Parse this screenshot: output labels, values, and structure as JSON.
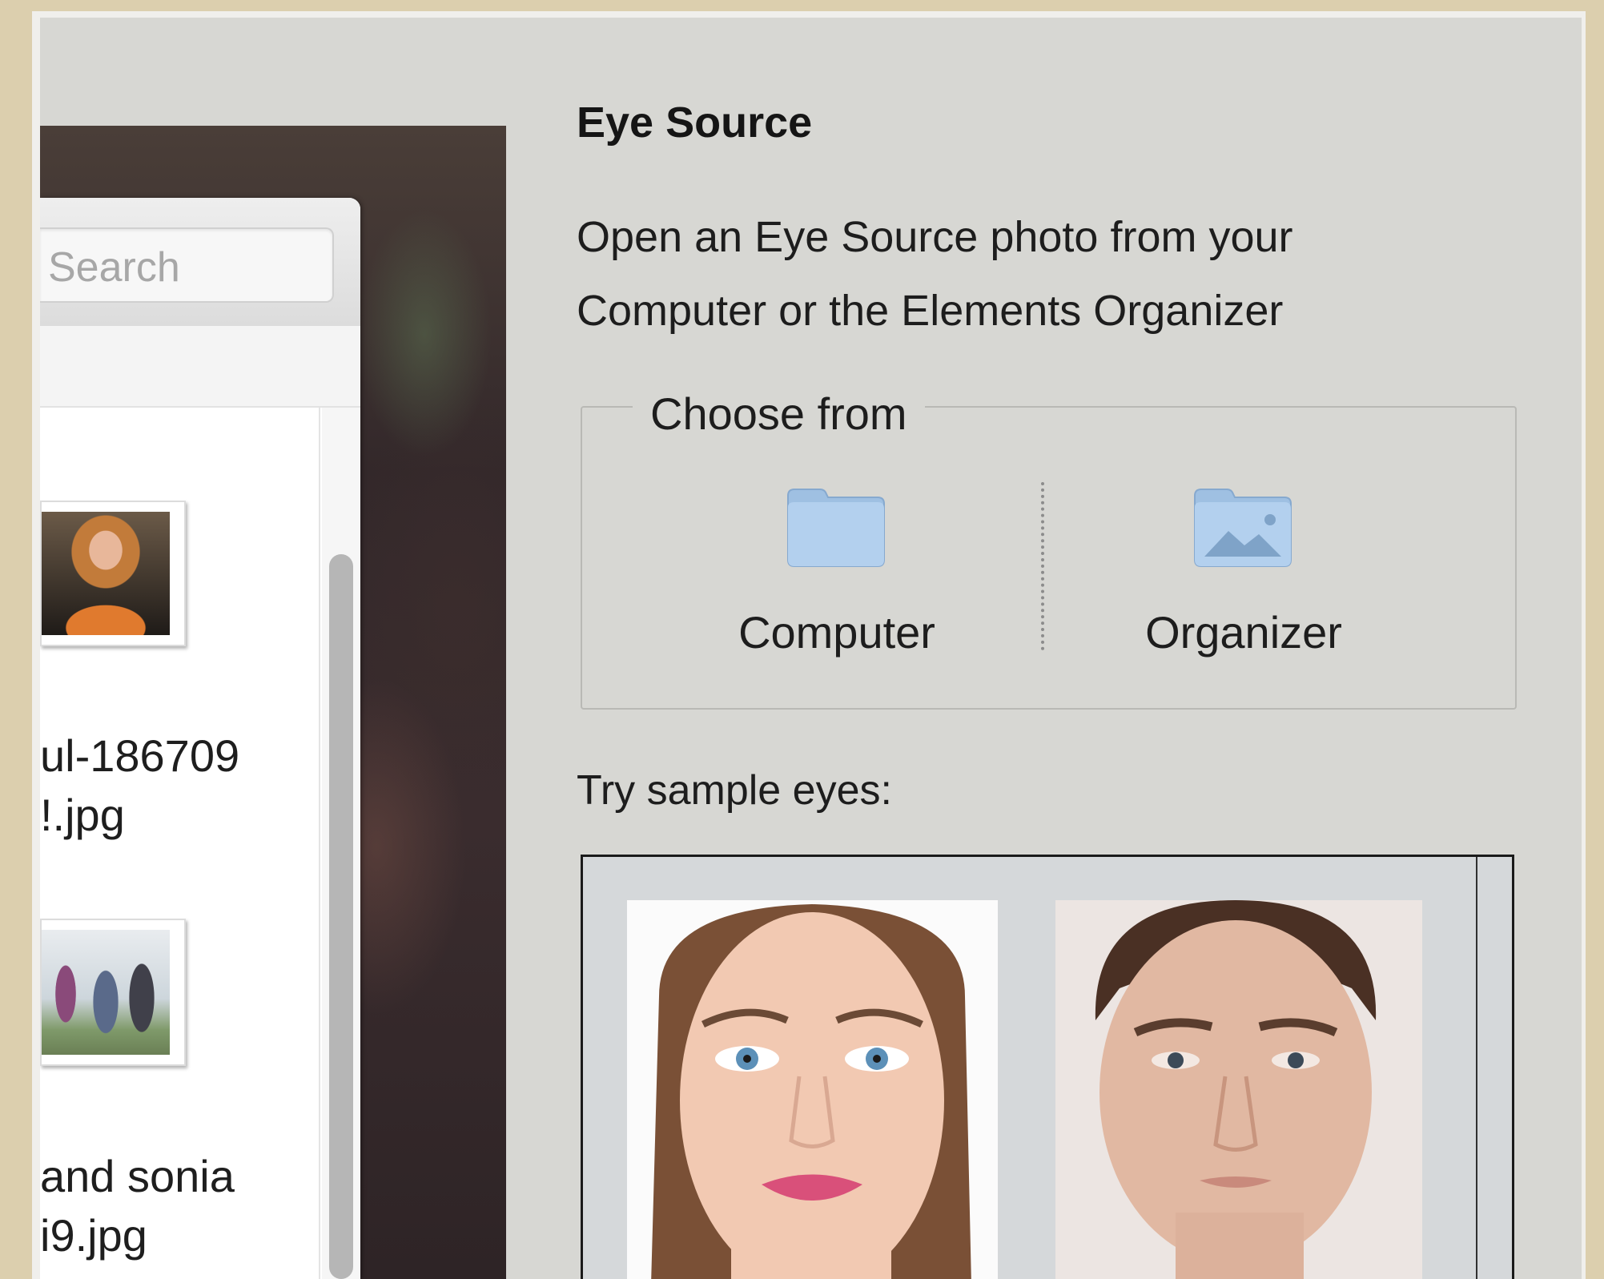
{
  "browser": {
    "search_placeholder": "Search",
    "files": [
      {
        "name_line1": "ul-186709",
        "name_line2": "!.jpg"
      },
      {
        "name_line1": "and sonia",
        "name_line2": "i9.jpg"
      }
    ]
  },
  "dialog": {
    "title": "Eye Source",
    "description": "Open an Eye Source photo from your Computer or the Elements Organizer",
    "choose_from_label": "Choose from",
    "choices": [
      {
        "label": "Computer",
        "icon": "folder-icon"
      },
      {
        "label": "Organizer",
        "icon": "photo-folder-icon"
      }
    ],
    "samples_label": "Try sample eyes:",
    "samples": [
      {
        "icon": "sample-face-female"
      },
      {
        "icon": "sample-face-male"
      }
    ]
  },
  "colors": {
    "panel_bg": "#d7d7d3",
    "icon_blue": "#a9c8e6",
    "outer_frame": "#dccfae"
  }
}
